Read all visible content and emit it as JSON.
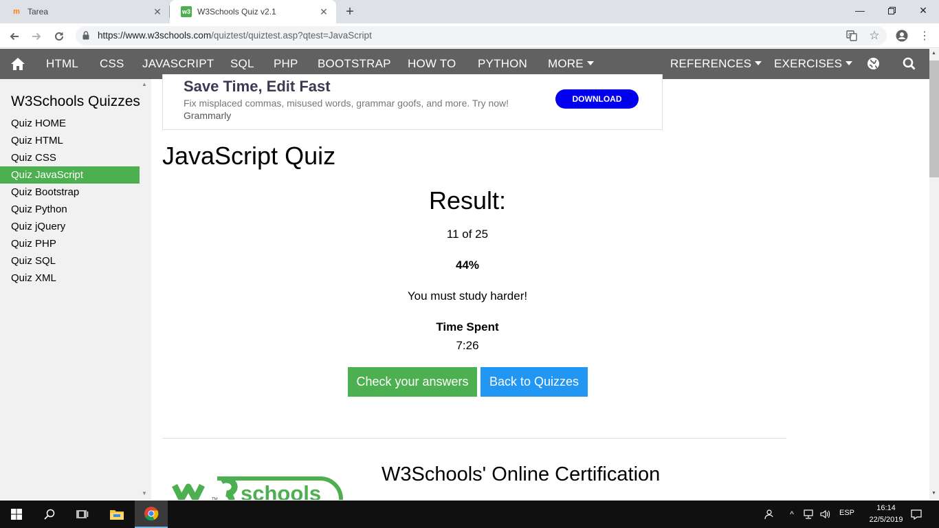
{
  "browser": {
    "tabs": [
      {
        "title": "Tarea",
        "active": false
      },
      {
        "title": "W3Schools Quiz v2.1",
        "active": true
      }
    ],
    "url_host": "https://www.w3schools.com",
    "url_path": "/quiztest/quiztest.asp?qtest=JavaScript"
  },
  "topnav": {
    "items": [
      "HTML",
      "CSS",
      "JAVASCRIPT",
      "SQL",
      "PHP",
      "BOOTSTRAP",
      "HOW TO",
      "PYTHON",
      "MORE"
    ],
    "right_items": [
      "REFERENCES",
      "EXERCISES"
    ]
  },
  "sidebar": {
    "title": "W3Schools Quizzes",
    "items": [
      "Quiz HOME",
      "Quiz HTML",
      "Quiz CSS",
      "Quiz JavaScript",
      "Quiz Bootstrap",
      "Quiz Python",
      "Quiz jQuery",
      "Quiz PHP",
      "Quiz SQL",
      "Quiz XML"
    ],
    "active_index": 3
  },
  "ad": {
    "headline": "Save Time, Edit Fast",
    "description": "Fix misplaced commas, misused words, grammar goofs, and more. Try now!",
    "brand": "Grammarly",
    "button": "DOWNLOAD"
  },
  "main": {
    "title": "JavaScript Quiz",
    "result_label": "Result:",
    "score": "11 of 25",
    "percent": "44%",
    "message": "You must study harder!",
    "time_label": "Time Spent",
    "time_value": "7:26",
    "check_button": "Check your answers",
    "back_button": "Back to Quizzes",
    "cert_title": "W3Schools' Online Certification",
    "logo_text": "schools",
    "logo_tm": "TM"
  },
  "taskbar": {
    "language": "ESP",
    "time": "16:14",
    "date": "22/5/2019"
  },
  "colors": {
    "nav_bg": "#616161",
    "active_green": "#4CAF50",
    "blue_button": "#2196F3",
    "ad_button": "#0000ee"
  }
}
